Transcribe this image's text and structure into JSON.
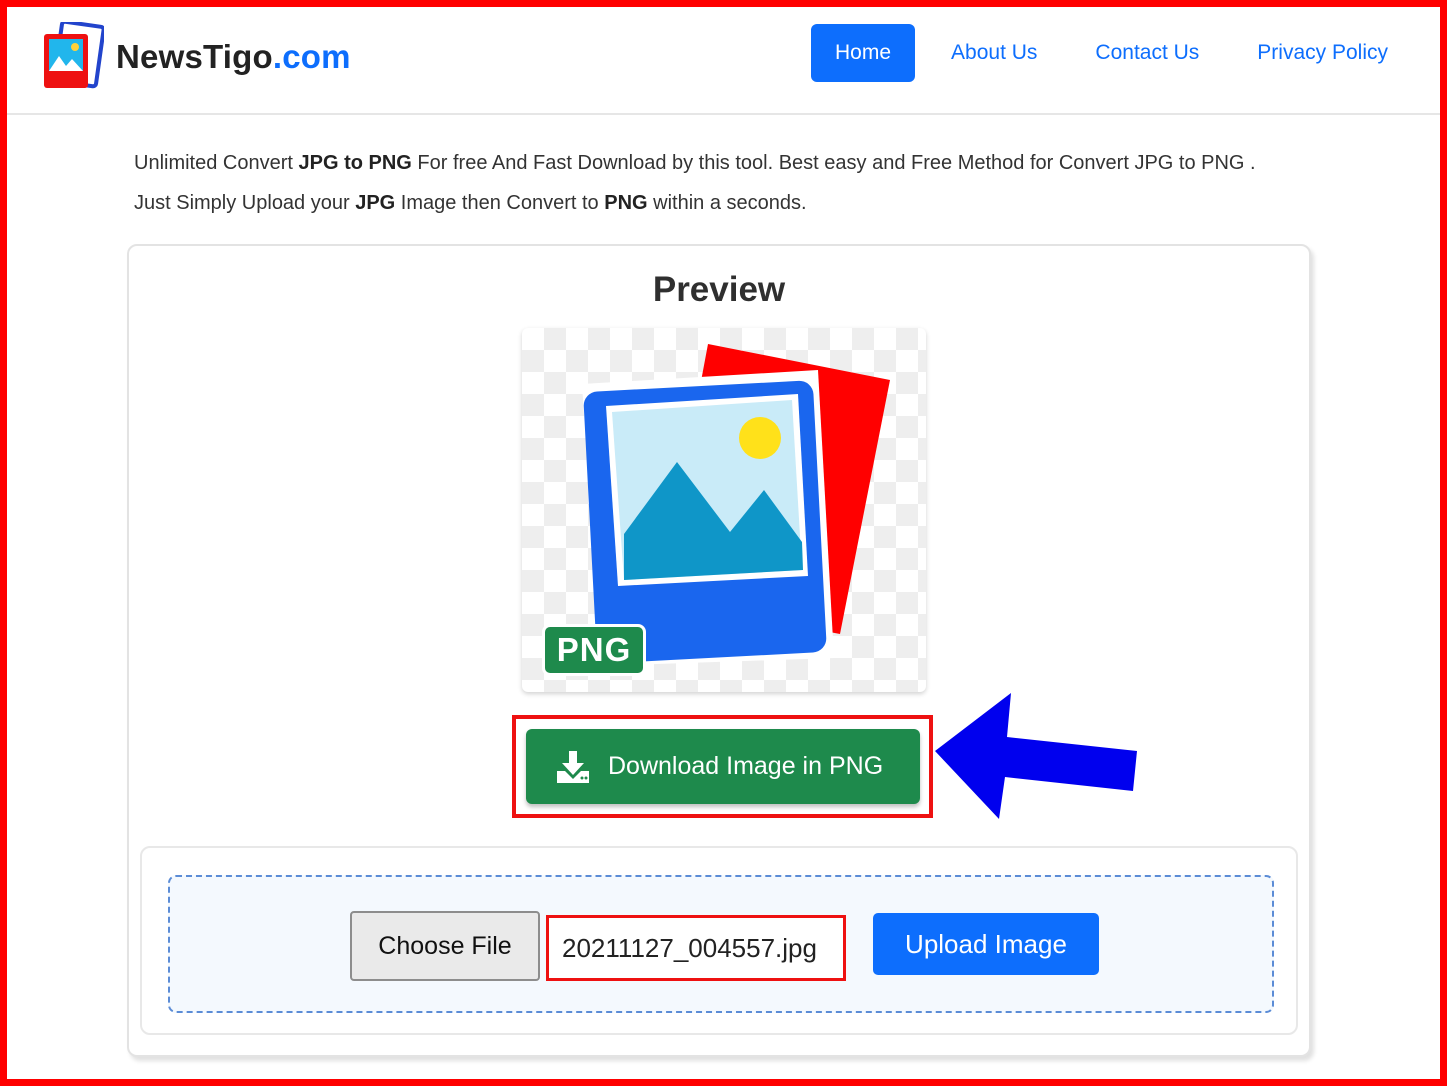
{
  "brand": {
    "name_main": "NewsTigo",
    "name_tld": ".com",
    "logo_icon": "image-gallery-icon"
  },
  "nav": {
    "items": [
      "Home",
      "About Us",
      "Contact Us",
      "Privacy Policy"
    ],
    "active": "Home"
  },
  "intro": {
    "line1": {
      "p1": "Unlimited Convert ",
      "b1": "JPG to PNG",
      "p2": " For free And Fast Download by this tool. Best easy and Free Method for Convert JPG to PNG ."
    },
    "line2": {
      "p1": "Just Simply Upload your ",
      "b1": "JPG",
      "p2": " Image then Convert to ",
      "b2": "PNG",
      "p3": " within a seconds."
    }
  },
  "preview": {
    "title": "Preview",
    "badge": "PNG"
  },
  "download": {
    "label": "Download Image in PNG",
    "icon": "download-icon"
  },
  "upload": {
    "choose_label": "Choose File",
    "file_name": "20211127_004557.jpg",
    "upload_label": "Upload Image"
  },
  "colors": {
    "accent": "#0d6efd",
    "success": "#1e8a4c",
    "highlight": "#ee1111",
    "arrow": "#0000ee",
    "frame": "#ff0000"
  }
}
